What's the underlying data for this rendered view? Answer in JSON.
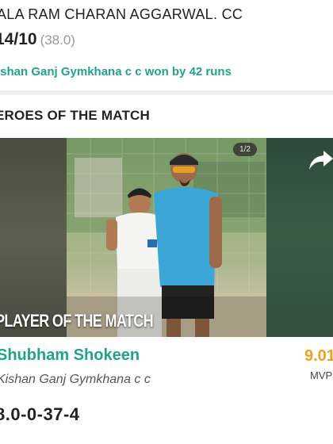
{
  "match": {
    "team_name": "ALA RAM CHARAN AGGARWAL. CC",
    "score": "14/10",
    "overs": "(38.0)",
    "result": "ishan Ganj Gymkhana c c won by 42 runs"
  },
  "heroes": {
    "title": "EROES OF THE MATCH",
    "counter": "1/2",
    "award_label": "PLAYER OF THE MATCH",
    "share_icon": "share-arrow-icon",
    "player": {
      "name": "Shubham Shokeen",
      "team": "Kishan Ganj Gymkhana c c",
      "mvp_value": "9.01",
      "mvp_label": "MVP",
      "figures": "8.0-0-37-4"
    }
  },
  "colors": {
    "accent_green": "#21a38a",
    "mvp_orange": "#f0a020"
  }
}
